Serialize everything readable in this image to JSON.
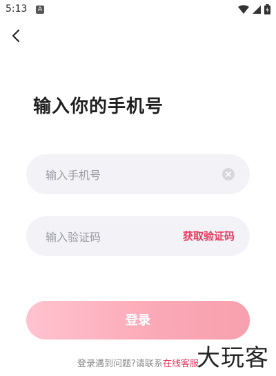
{
  "status_bar": {
    "time": "5:13",
    "app_icon_letter": "A"
  },
  "page": {
    "title": "输入你的手机号"
  },
  "phone_field": {
    "placeholder": "输入手机号",
    "value": ""
  },
  "code_field": {
    "placeholder": "输入验证码",
    "value": "",
    "get_code_label": "获取验证码"
  },
  "login_button": {
    "label": "登录"
  },
  "help": {
    "text": "登录遇到问题?请联系",
    "link": "在线客服"
  },
  "watermark": {
    "text": "大玩客"
  },
  "colors": {
    "accent": "#e8385c",
    "button_start": "#ffc3cf",
    "button_end": "#f8a0ae",
    "field_bg": "#f3f2f7"
  },
  "icons": {
    "back": "chevron-left-icon",
    "clear": "close-circle-icon",
    "wifi": "wifi-icon",
    "signal": "signal-icon",
    "battery": "battery-icon"
  }
}
